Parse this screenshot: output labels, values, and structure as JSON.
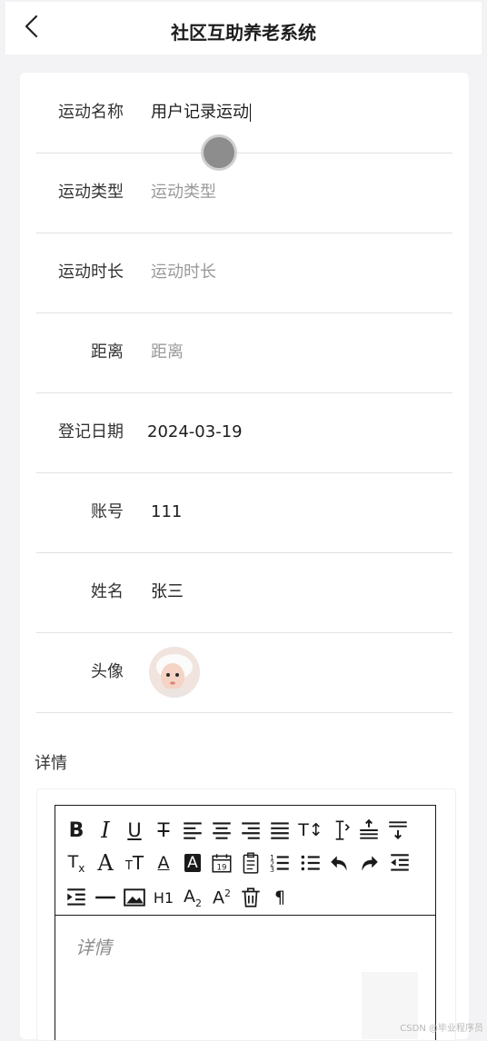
{
  "header": {
    "title": "社区互助养老系统",
    "back_icon": "chevron-left-icon"
  },
  "form": {
    "rows": [
      {
        "label": "运动名称",
        "value": "用户记录运动",
        "placeholder": ""
      },
      {
        "label": "运动类型",
        "value": "",
        "placeholder": "运动类型"
      },
      {
        "label": "运动时长",
        "value": "",
        "placeholder": "运动时长"
      },
      {
        "label": "距离",
        "value": "",
        "placeholder": "距离"
      },
      {
        "label": "登记日期",
        "value": "2024-03-19",
        "placeholder": ""
      },
      {
        "label": "账号",
        "value": "111",
        "placeholder": ""
      },
      {
        "label": "姓名",
        "value": "张三",
        "placeholder": ""
      },
      {
        "label": "头像",
        "value": "",
        "placeholder": ""
      }
    ],
    "detail_label": "详情",
    "editor": {
      "placeholder": "详情",
      "toolbar": [
        "bold-icon",
        "italic-icon",
        "underline-icon",
        "strikethrough-icon",
        "align-left-icon",
        "align-center-icon",
        "align-right-icon",
        "align-justify-icon",
        "font-size-icon",
        "line-height-icon",
        "paragraph-spacing-before-icon",
        "paragraph-spacing-after-icon",
        "clear-format-icon",
        "font-family-icon",
        "letter-spacing-icon",
        "font-color-icon",
        "background-color-icon",
        "date-icon",
        "clipboard-icon",
        "ordered-list-icon",
        "unordered-list-icon",
        "undo-icon",
        "redo-icon",
        "outdent-icon",
        "indent-icon",
        "horizontal-rule-icon",
        "image-icon",
        "heading-icon",
        "subscript-icon",
        "superscript-icon",
        "delete-icon",
        "paragraph-mark-icon"
      ]
    }
  },
  "watermark": "CSDN @毕业程序员",
  "colors": {
    "placeholder": "#9a9a9a",
    "text": "#1d1d1d",
    "divider": "#e2e2e2",
    "page_bg": "#f3f3f6"
  }
}
